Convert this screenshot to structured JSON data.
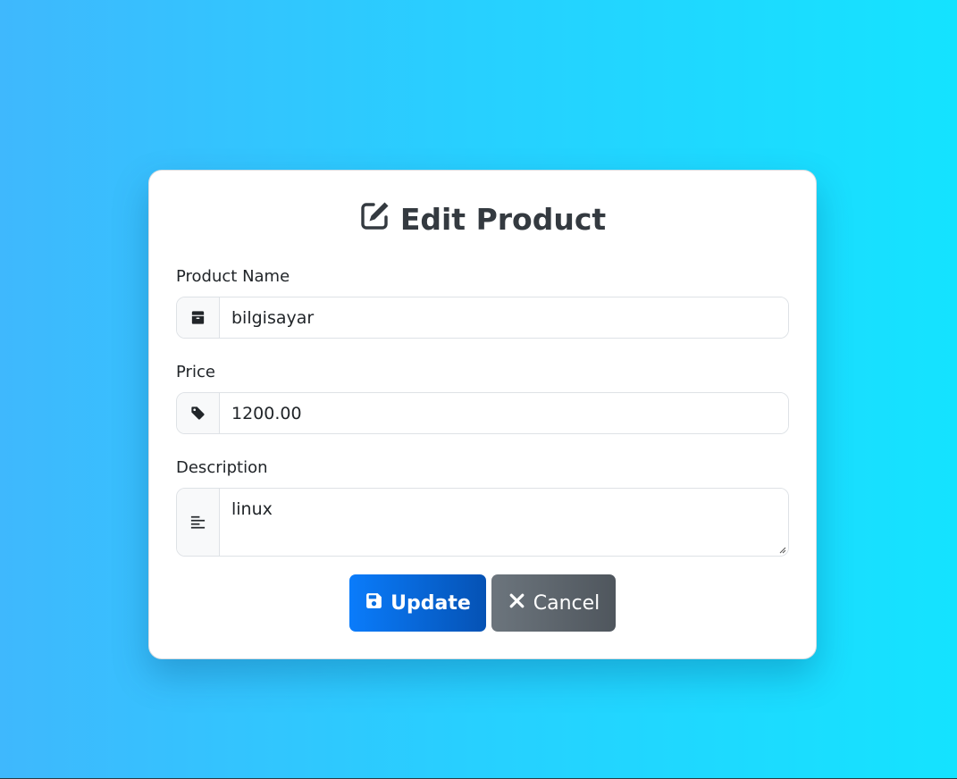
{
  "form": {
    "title": "Edit Product",
    "title_icon": "edit-icon",
    "fields": {
      "name": {
        "label": "Product Name",
        "value": "bilgisayar",
        "icon": "box-icon"
      },
      "price": {
        "label": "Price",
        "value": "1200.00",
        "icon": "tag-icon"
      },
      "description": {
        "label": "Description",
        "value": "linux",
        "icon": "align-left-icon"
      }
    },
    "buttons": {
      "update": {
        "label": "Update",
        "icon": "save-icon",
        "color": "#0a7cfb"
      },
      "cancel": {
        "label": "Cancel",
        "icon": "close-icon",
        "color": "#6c757d"
      }
    }
  },
  "theme": {
    "background_start": "#3fb8fd",
    "background_end": "#14e3ff",
    "card_background": "#ffffff",
    "title_color": "#343a40"
  }
}
